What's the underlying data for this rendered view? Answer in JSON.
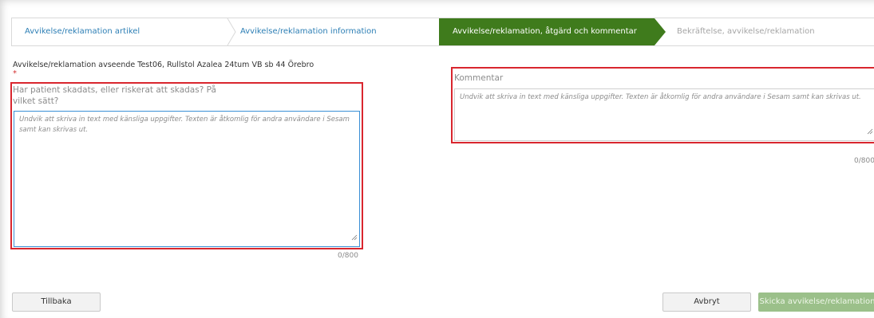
{
  "wizard": {
    "steps": [
      {
        "label": "Avvikelse/reklamation artikel",
        "state": "done"
      },
      {
        "label": "Avvikelse/reklamation information",
        "state": "done"
      },
      {
        "label": "Avvikelse/reklamation, åtgärd och kommentar",
        "state": "active"
      },
      {
        "label": "Bekräftelse, avvikelse/reklamation",
        "state": "upcoming"
      }
    ],
    "active_color": "#3f7b1c",
    "link_color": "#2d7fb5"
  },
  "form": {
    "subject": "Avvikelse/reklamation avseende Test06, Rullstol Azalea 24tum VB sb 44 Örebro",
    "required_marker": "*",
    "injury_question": "Har patient skadats, eller riskerat att skadas? På vilket sätt?",
    "injury_placeholder": "Undvik att skriva in text med känsliga uppgifter. Texten är åtkomlig för andra användare i Sesam samt kan skrivas ut.",
    "injury_counter": "0/800",
    "comment_label": "Kommentar",
    "comment_placeholder": "Undvik att skriva in text med känsliga uppgifter. Texten är åtkomlig för andra användare i Sesam samt kan skrivas ut.",
    "comment_counter": "0/800"
  },
  "buttons": {
    "back": "Tillbaka",
    "cancel": "Avbryt",
    "submit": "Skicka avvikelse/reklamation"
  },
  "colors": {
    "highlight_border": "#d9262e",
    "focus_border": "#3a8fd6",
    "submit_disabled": "#9bc08a"
  }
}
